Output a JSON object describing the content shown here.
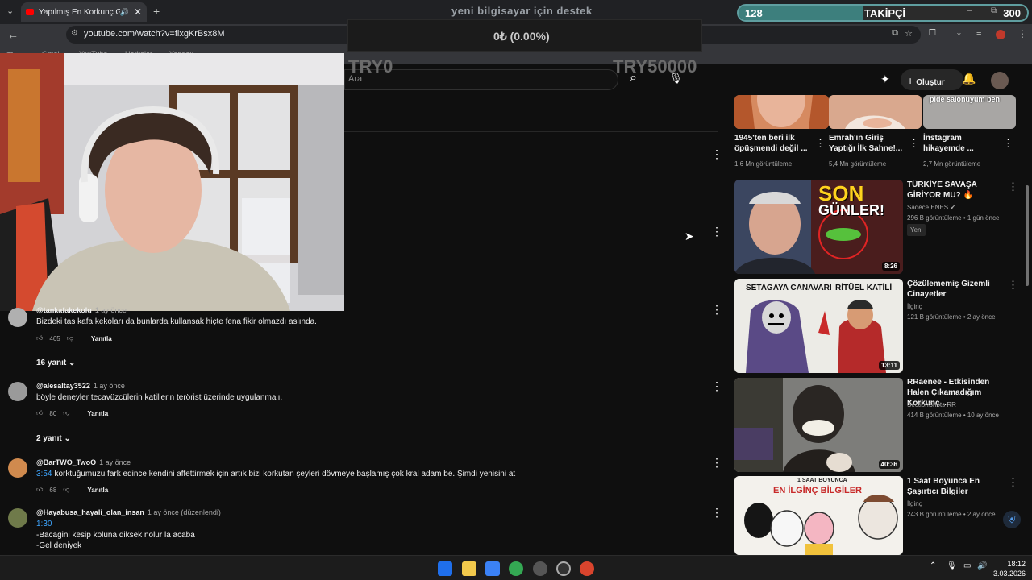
{
  "browser": {
    "tab_title": "Yapılmış En Korkunç Gerçek",
    "url": "youtube.com/watch?v=flxgKrBsx8M",
    "bookmarks": [
      "Gmail",
      "YouTube",
      "Haritalar",
      "Yandex"
    ]
  },
  "overlay": {
    "stream_title": "yeni bilgisayar için destek",
    "donate_amount": "0₺ (0.00%)",
    "donate_start": "TRY0",
    "donate_goal": "TRY50000",
    "followers_current": "128",
    "followers_label": "TAKİPÇİ",
    "followers_goal": "300",
    "followers_progress": 0.43
  },
  "yt_header": {
    "search_placeholder": "Ara",
    "create_label": "Oluştur"
  },
  "comments": [
    {
      "author": "@tankafakekolu",
      "ago": "1 ay önce",
      "text": "Bizdeki tas kafa kekoları da bunlarda kullansak hiçte fena fikir olmazdı aslında.",
      "likes": "465",
      "reply_label": "Yanıtla",
      "replies": "16 yanıt",
      "avatar_color": "#b0b0b0"
    },
    {
      "author": "@alesaltay3522",
      "ago": "1 ay önce",
      "text": "böyle deneyler  tecavüzcülerin katillerin terörist üzerinde uygulanmalı.",
      "likes": "80",
      "reply_label": "Yanıtla",
      "replies": "2 yanıt",
      "avatar_color": "#9a9a9a"
    },
    {
      "author": "@BarTWO_TwoO",
      "ago": "1 ay önce",
      "timestamp": "3:54",
      "text": "korktuğumuzu fark edince kendini affettirmek için artık bizi korkutan şeyleri dövmeye başlamış çok kral adam be. Şimdi yenisini at",
      "likes": "68",
      "reply_label": "Yanıtla",
      "avatar_color": "#d08a4e"
    },
    {
      "author": "@Hayabusa_hayali_olan_insan",
      "ago": "1 ay önce (düzenlendi)",
      "timestamp": "1:30",
      "lines": [
        "-Bacagini kesip koluna diksek nolur la acaba",
        "-Gel deniyek"
      ],
      "avatar_color": "#6f7a4a"
    }
  ],
  "side_top": [
    {
      "title": "1945'ten beri ilk öpüşmendi değil ...",
      "views": "1,6 Mn görüntüleme"
    },
    {
      "title": "Emrah'ın Giriş Yaptığı İlk Sahne!...",
      "views": "5,4 Mn görüntüleme"
    },
    {
      "title": "İnstagram hikayemde ...",
      "views": "2,7 Mn görüntüleme",
      "thumb_text": "pide salonuyum ben"
    }
  ],
  "side_videos": [
    {
      "title": "TÜRKİYE SAVAŞA GİRİYOR MU? 🔥",
      "channel": "Sadece ENES ✔",
      "meta": "296 B görüntüleme • 1 gün önce",
      "badge": "Yeni",
      "duration": "8:26",
      "thumb_text1": "SON",
      "thumb_text2": "GÜNLER!"
    },
    {
      "title": "Çözülememiş Gizemli Cinayetler",
      "channel": "İlginç",
      "meta": "121 B görüntüleme • 2 ay önce",
      "duration": "13:11",
      "thumb_text1": "SETAGAYA CANAVARI",
      "thumb_text2": "RİTÜEL KATİLİ"
    },
    {
      "title": "RRaenee - Etkisinden Halen Çıkamadığım Korkunç ...",
      "channel": "SectionShots RR",
      "meta": "414 B görüntüleme • 10 ay önce",
      "duration": "40:36"
    },
    {
      "title": "1 Saat Boyunca En Şaşırtıcı Bilgiler",
      "channel": "İlginç",
      "meta": "243 B görüntüleme • 2 ay önce",
      "thumb_text1": "1 SAAT BOYUNCA",
      "thumb_text2": "EN İLGİNÇ BİLGİLER"
    }
  ],
  "clock": {
    "time": "18:12",
    "date": "3.03.2026"
  },
  "colors": {
    "youtube_red": "#ff0000",
    "link_blue": "#3ea6ff",
    "follower_bar": "#3d7f7d"
  }
}
